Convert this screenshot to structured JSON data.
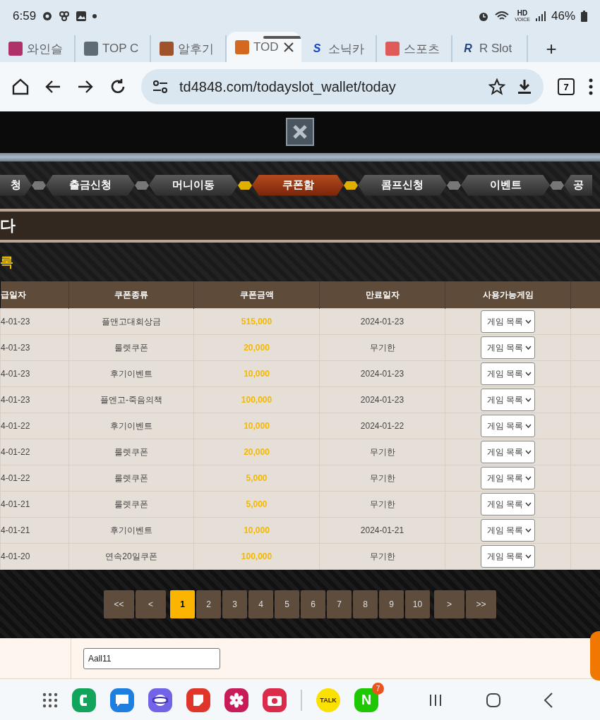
{
  "status_bar": {
    "time": "6:59",
    "hd": "HD",
    "voice": "VOICE",
    "battery": "46%"
  },
  "browser_tabs": [
    {
      "label": "와인슬",
      "selected": false
    },
    {
      "label": "TOP C",
      "selected": false
    },
    {
      "label": "알후기",
      "selected": false
    },
    {
      "label": "TOD",
      "selected": true
    },
    {
      "label": "소닉카",
      "selected": false,
      "favicon_text": "S"
    },
    {
      "label": "스포츠",
      "selected": false
    },
    {
      "label": "R Slot",
      "selected": false,
      "favicon_text": "R"
    }
  ],
  "new_tab": "+",
  "address_bar": {
    "url": "td4848.com/todayslot_wallet/today",
    "tab_count": "7"
  },
  "nav": [
    {
      "label": "청",
      "selected": false
    },
    {
      "label": "출금신청",
      "selected": false
    },
    {
      "label": "머니이동",
      "selected": false
    },
    {
      "label": "쿠폰함",
      "selected": true
    },
    {
      "label": "콤프신청",
      "selected": false
    },
    {
      "label": "이벤트",
      "selected": false
    },
    {
      "label": "공",
      "selected": false
    }
  ],
  "page_title": "다",
  "section_title": "록",
  "table": {
    "columns": [
      "급일자",
      "쿠폰종류",
      "쿠폰금액",
      "만료일자",
      "사용가능게임"
    ],
    "rows": [
      {
        "issued": "4-01-23",
        "type": "플앤고대회상금",
        "amount": "515,000",
        "expires": "2024-01-23",
        "games": "게임 목록"
      },
      {
        "issued": "4-01-23",
        "type": "룰렛쿠폰",
        "amount": "20,000",
        "expires": "무기한",
        "games": "게임 목록"
      },
      {
        "issued": "4-01-23",
        "type": "후기이벤트",
        "amount": "10,000",
        "expires": "2024-01-23",
        "games": "게임 목록"
      },
      {
        "issued": "4-01-23",
        "type": "플엔고-죽음의책",
        "amount": "100,000",
        "expires": "2024-01-23",
        "games": "게임 목록"
      },
      {
        "issued": "4-01-22",
        "type": "후기이벤트",
        "amount": "10,000",
        "expires": "2024-01-22",
        "games": "게임 목록"
      },
      {
        "issued": "4-01-22",
        "type": "룰렛쿠폰",
        "amount": "20,000",
        "expires": "무기한",
        "games": "게임 목록"
      },
      {
        "issued": "4-01-22",
        "type": "룰렛쿠폰",
        "amount": "5,000",
        "expires": "무기한",
        "games": "게임 목록"
      },
      {
        "issued": "4-01-21",
        "type": "룰렛쿠폰",
        "amount": "5,000",
        "expires": "무기한",
        "games": "게임 목록"
      },
      {
        "issued": "4-01-21",
        "type": "후기이벤트",
        "amount": "10,000",
        "expires": "2024-01-21",
        "games": "게임 목록"
      },
      {
        "issued": "4-01-20",
        "type": "연속20일쿠폰",
        "amount": "100,000",
        "expires": "무기한",
        "games": "게임 목록"
      }
    ]
  },
  "pagination": [
    {
      "label": "<<",
      "selected": false
    },
    {
      "label": "<",
      "selected": false
    },
    {
      "label": "1",
      "selected": true
    },
    {
      "label": "2",
      "selected": false
    },
    {
      "label": "3",
      "selected": false
    },
    {
      "label": "4",
      "selected": false
    },
    {
      "label": "5",
      "selected": false
    },
    {
      "label": "6",
      "selected": false
    },
    {
      "label": "7",
      "selected": false
    },
    {
      "label": "8",
      "selected": false
    },
    {
      "label": "9",
      "selected": false
    },
    {
      "label": "10",
      "selected": false
    },
    {
      "label": ">",
      "selected": false
    },
    {
      "label": ">>",
      "selected": false
    }
  ],
  "form": {
    "value": "Aall11"
  },
  "dock": {
    "talk": "TALK",
    "naver": "N",
    "naver_badge": "7"
  }
}
